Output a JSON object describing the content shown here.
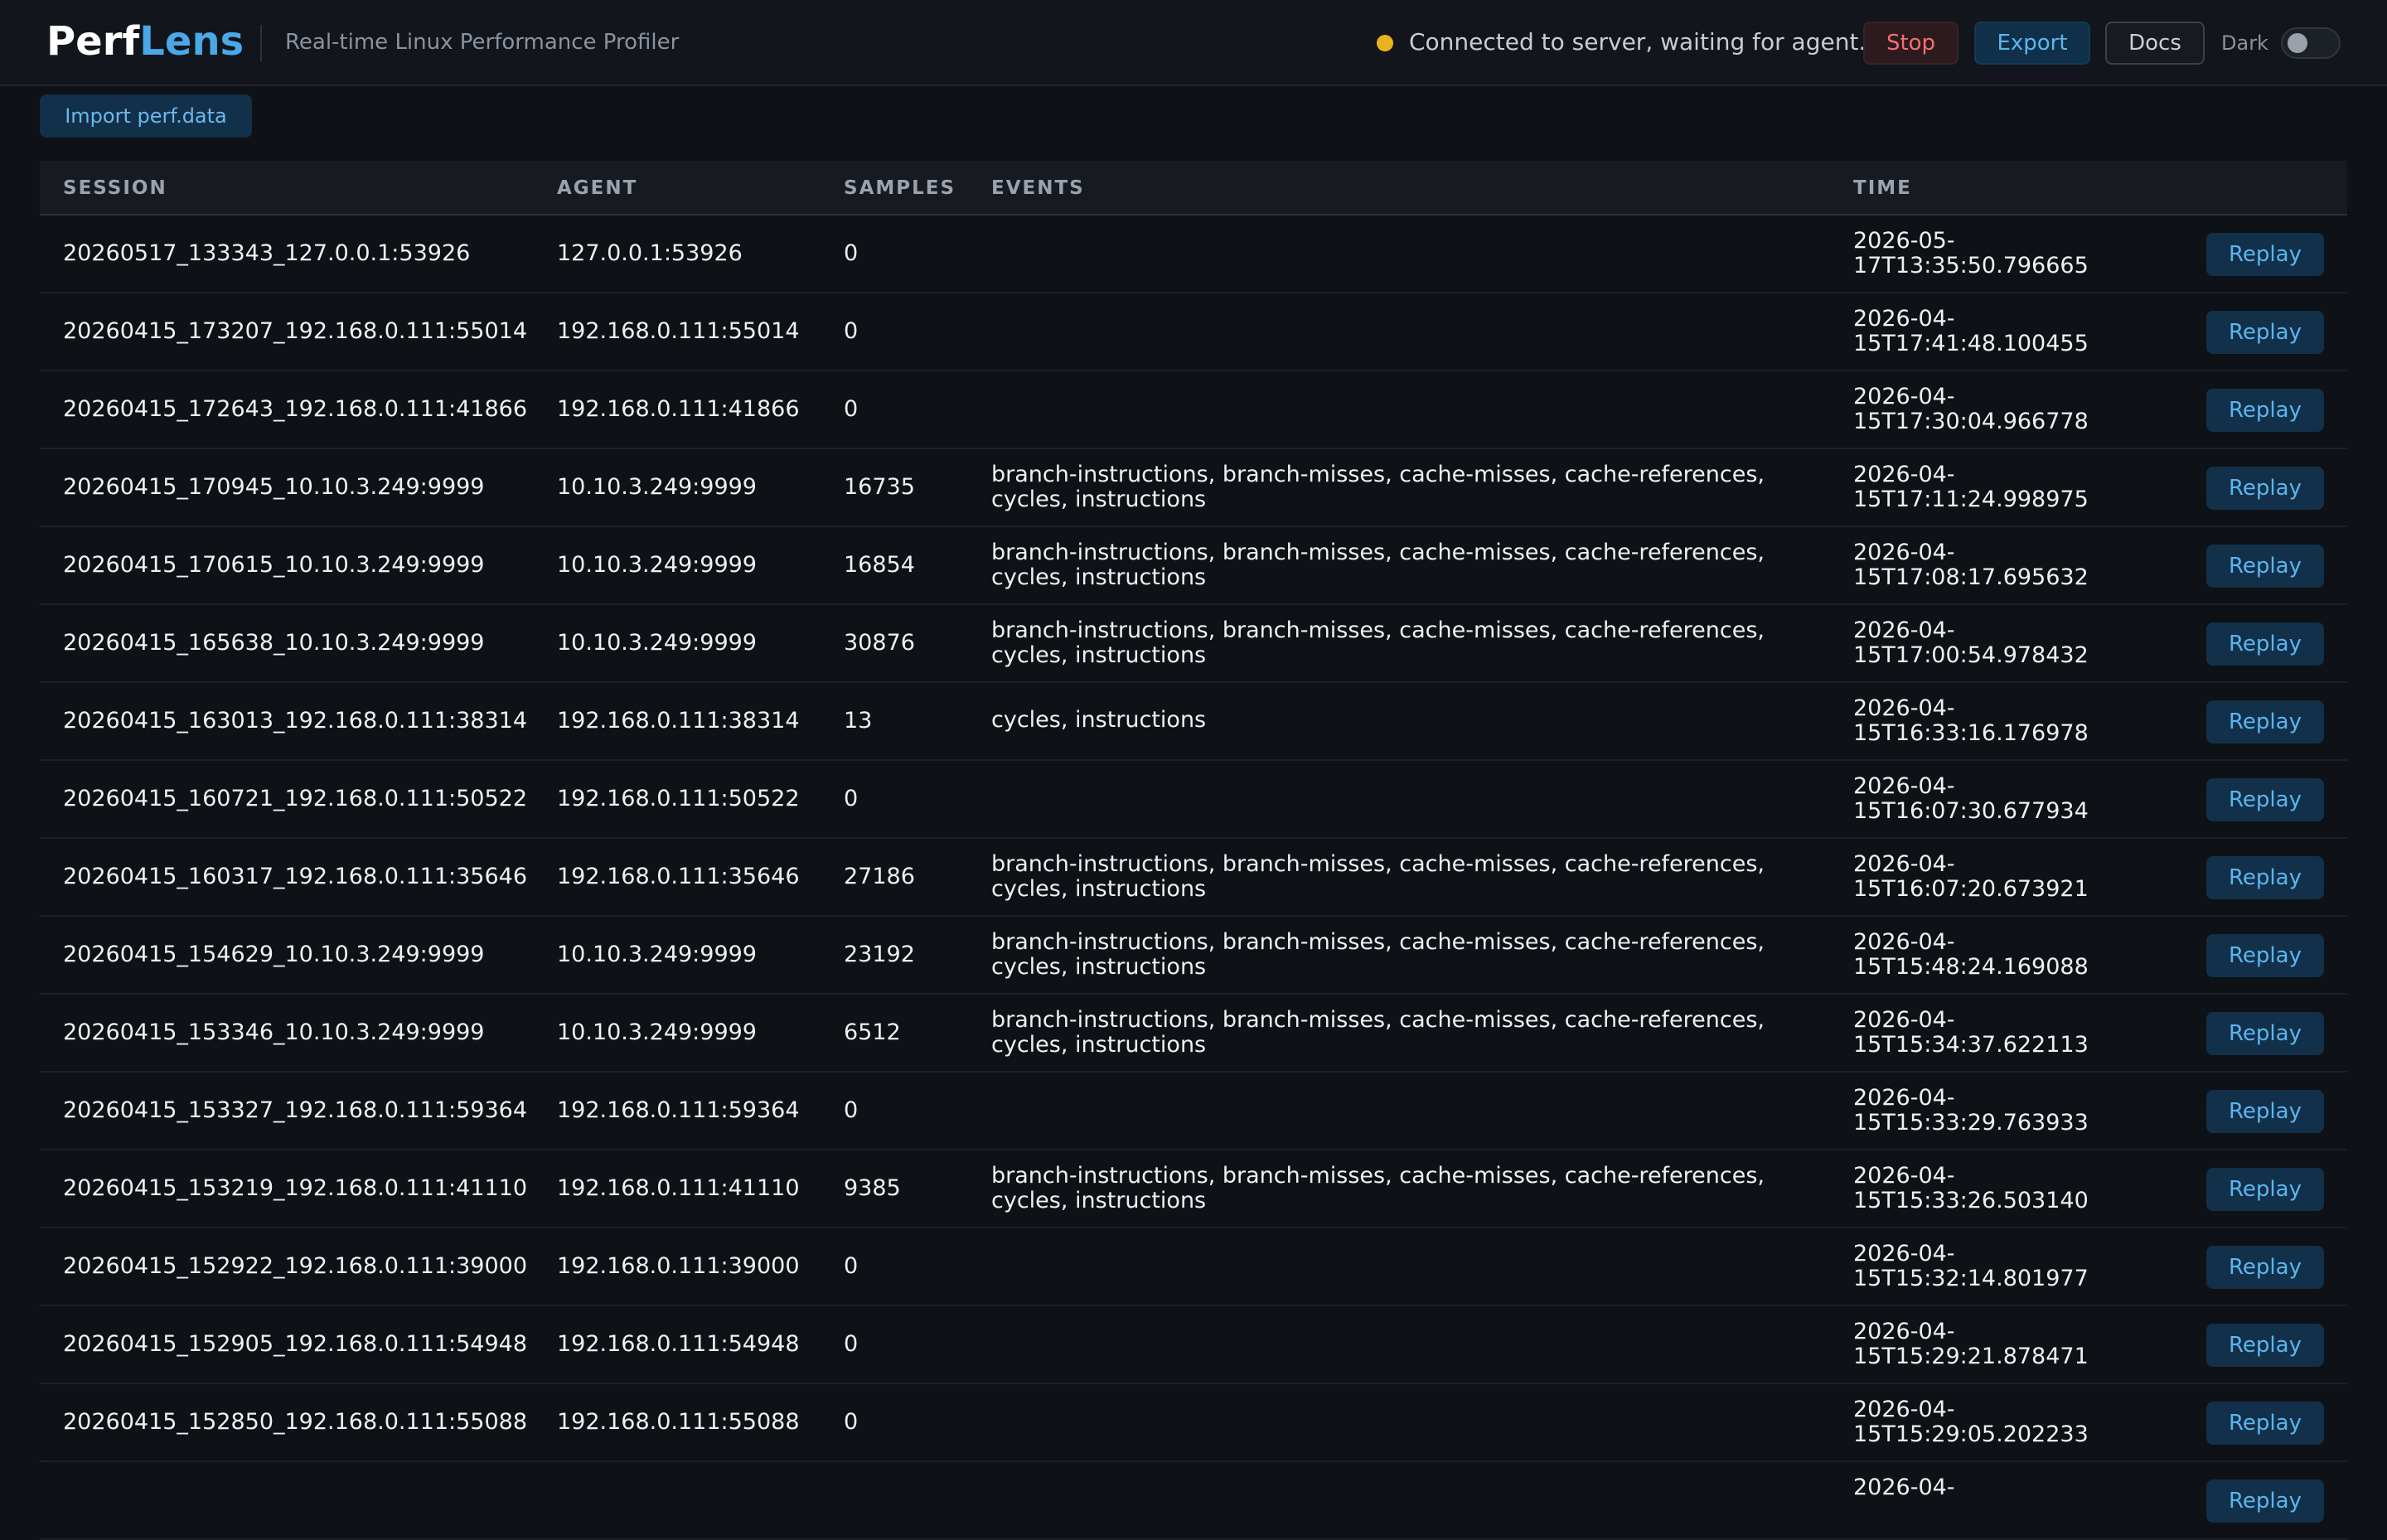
{
  "header": {
    "brand_part1": "Perf",
    "brand_part2": "Lens",
    "subtitle": "Real-time Linux Performance Profiler",
    "status": "Connected to server, waiting for agent...",
    "stop_label": "Stop",
    "export_label": "Export",
    "docs_label": "Docs",
    "dark_label": "Dark",
    "dark_mode_on": false
  },
  "colors": {
    "accent": "#4aa8e8",
    "status_waiting": "#e8b31c",
    "stop": "#f2706f",
    "background": "#0e1116"
  },
  "toolbar": {
    "import_label": "Import perf.data"
  },
  "table": {
    "columns": [
      "SESSION",
      "AGENT",
      "SAMPLES",
      "EVENTS",
      "TIME"
    ],
    "replay_label": "Replay",
    "rows": [
      {
        "session": "20260517_133343_127.0.0.1:53926",
        "agent": "127.0.0.1:53926",
        "samples": "0",
        "events": "",
        "time": "2026-05-17T13:35:50.796665"
      },
      {
        "session": "20260415_173207_192.168.0.111:55014",
        "agent": "192.168.0.111:55014",
        "samples": "0",
        "events": "",
        "time": "2026-04-15T17:41:48.100455"
      },
      {
        "session": "20260415_172643_192.168.0.111:41866",
        "agent": "192.168.0.111:41866",
        "samples": "0",
        "events": "",
        "time": "2026-04-15T17:30:04.966778"
      },
      {
        "session": "20260415_170945_10.10.3.249:9999",
        "agent": "10.10.3.249:9999",
        "samples": "16735",
        "events": "branch-instructions, branch-misses, cache-misses, cache-references, cycles, instructions",
        "time": "2026-04-15T17:11:24.998975"
      },
      {
        "session": "20260415_170615_10.10.3.249:9999",
        "agent": "10.10.3.249:9999",
        "samples": "16854",
        "events": "branch-instructions, branch-misses, cache-misses, cache-references, cycles, instructions",
        "time": "2026-04-15T17:08:17.695632"
      },
      {
        "session": "20260415_165638_10.10.3.249:9999",
        "agent": "10.10.3.249:9999",
        "samples": "30876",
        "events": "branch-instructions, branch-misses, cache-misses, cache-references, cycles, instructions",
        "time": "2026-04-15T17:00:54.978432"
      },
      {
        "session": "20260415_163013_192.168.0.111:38314",
        "agent": "192.168.0.111:38314",
        "samples": "13",
        "events": "cycles, instructions",
        "time": "2026-04-15T16:33:16.176978"
      },
      {
        "session": "20260415_160721_192.168.0.111:50522",
        "agent": "192.168.0.111:50522",
        "samples": "0",
        "events": "",
        "time": "2026-04-15T16:07:30.677934"
      },
      {
        "session": "20260415_160317_192.168.0.111:35646",
        "agent": "192.168.0.111:35646",
        "samples": "27186",
        "events": "branch-instructions, branch-misses, cache-misses, cache-references, cycles, instructions",
        "time": "2026-04-15T16:07:20.673921"
      },
      {
        "session": "20260415_154629_10.10.3.249:9999",
        "agent": "10.10.3.249:9999",
        "samples": "23192",
        "events": "branch-instructions, branch-misses, cache-misses, cache-references, cycles, instructions",
        "time": "2026-04-15T15:48:24.169088"
      },
      {
        "session": "20260415_153346_10.10.3.249:9999",
        "agent": "10.10.3.249:9999",
        "samples": "6512",
        "events": "branch-instructions, branch-misses, cache-misses, cache-references, cycles, instructions",
        "time": "2026-04-15T15:34:37.622113"
      },
      {
        "session": "20260415_153327_192.168.0.111:59364",
        "agent": "192.168.0.111:59364",
        "samples": "0",
        "events": "",
        "time": "2026-04-15T15:33:29.763933"
      },
      {
        "session": "20260415_153219_192.168.0.111:41110",
        "agent": "192.168.0.111:41110",
        "samples": "9385",
        "events": "branch-instructions, branch-misses, cache-misses, cache-references, cycles, instructions",
        "time": "2026-04-15T15:33:26.503140"
      },
      {
        "session": "20260415_152922_192.168.0.111:39000",
        "agent": "192.168.0.111:39000",
        "samples": "0",
        "events": "",
        "time": "2026-04-15T15:32:14.801977"
      },
      {
        "session": "20260415_152905_192.168.0.111:54948",
        "agent": "192.168.0.111:54948",
        "samples": "0",
        "events": "",
        "time": "2026-04-15T15:29:21.878471"
      },
      {
        "session": "20260415_152850_192.168.0.111:55088",
        "agent": "192.168.0.111:55088",
        "samples": "0",
        "events": "",
        "time": "2026-04-15T15:29:05.202233"
      },
      {
        "session": "",
        "agent": "",
        "samples": "",
        "events": "",
        "time": "2026-04-"
      }
    ]
  }
}
